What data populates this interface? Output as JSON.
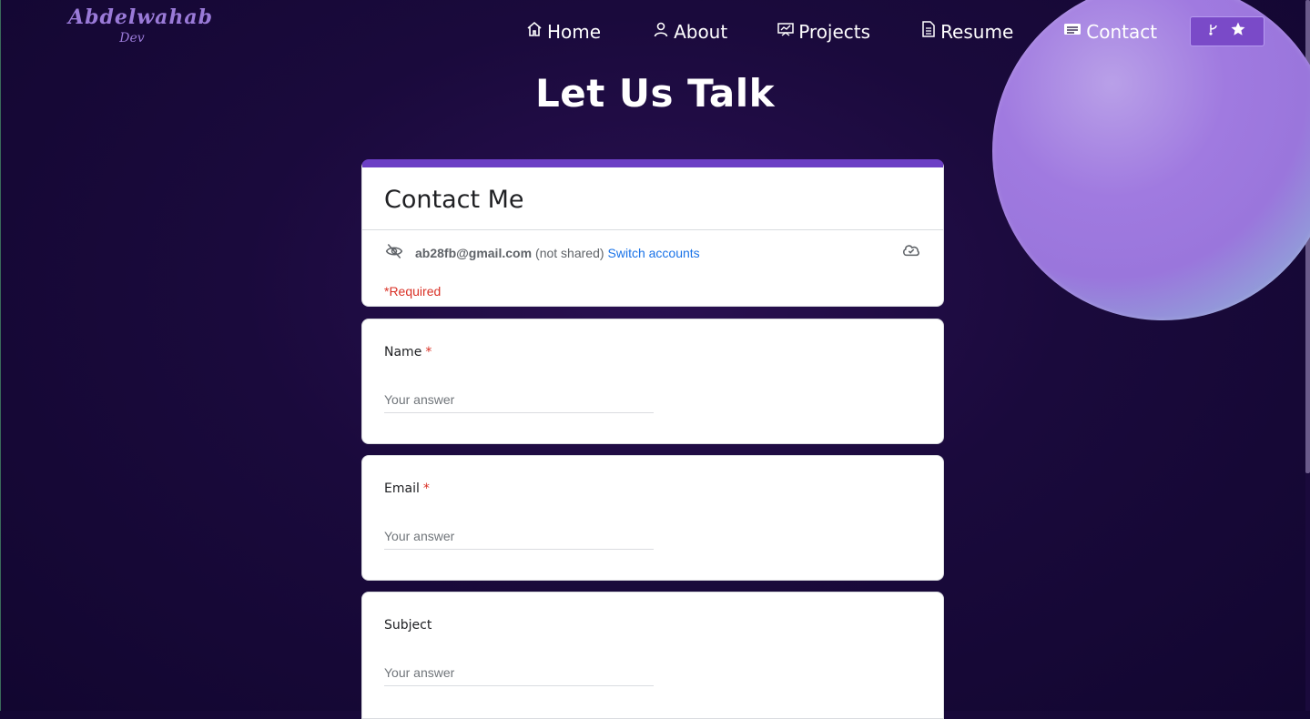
{
  "logo": {
    "name": "Abdelwahab",
    "sub": "Dev"
  },
  "nav": {
    "home": "Home",
    "about": "About",
    "projects": "Projects",
    "resume": "Resume",
    "contact": "Contact"
  },
  "headline": "Let Us Talk",
  "form": {
    "title": "Contact Me",
    "account_email": "ab28fb@gmail.com",
    "not_shared": "(not shared)",
    "switch_accounts": "Switch accounts",
    "required_note": "*Required",
    "questions": [
      {
        "label": "Name",
        "required": "*",
        "placeholder": "Your answer"
      },
      {
        "label": "Email",
        "required": "*",
        "placeholder": "Your answer"
      },
      {
        "label": "Subject",
        "placeholder": "Your answer"
      }
    ]
  },
  "colors": {
    "accent": "#6c3fc5",
    "link": "#1a73e8",
    "required": "#d93025",
    "background": "#1a0a3c"
  },
  "icons": [
    "home-icon",
    "user-icon",
    "projects-icon",
    "resume-icon",
    "contact-icon",
    "fork-icon",
    "star-icon",
    "eye-off-icon",
    "cloud-check-icon"
  ]
}
